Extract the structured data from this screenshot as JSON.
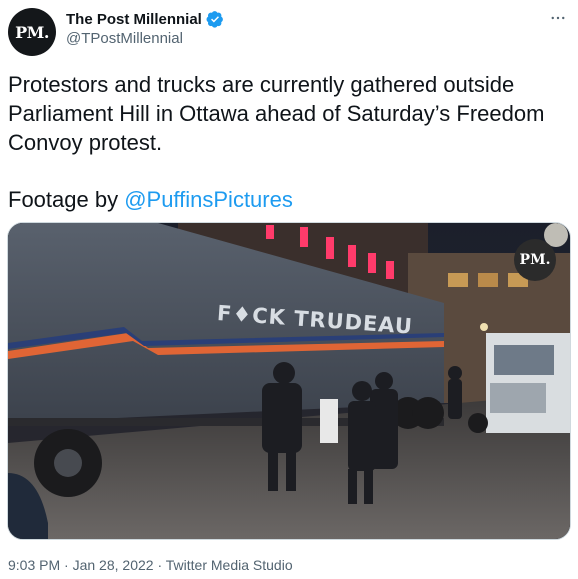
{
  "account": {
    "avatar_text": "PM.",
    "display_name": "The Post Millennial",
    "handle": "@TPostMillennial",
    "verified": true
  },
  "tweet": {
    "text_line1": "Protestors and trucks are currently gathered outside Parliament Hill in Ottawa ahead of Saturday’s Freedom Convoy protest.",
    "footage_prefix": "Footage by ",
    "footage_mention": "@PuffinsPictures"
  },
  "media": {
    "watermark_text": "PM.",
    "truck_text": "F♦CK TRUDEAU"
  },
  "meta": {
    "time": "9:03 PM",
    "separator1": " · ",
    "date": "Jan 28, 2022",
    "separator2": " · ",
    "source": "Twitter Media Studio"
  },
  "colors": {
    "link": "#1d9bf0",
    "secondary_text": "#536471",
    "verified": "#1d9bf0"
  },
  "icons": {
    "verified": "verified-badge-icon",
    "more": "more-icon"
  }
}
